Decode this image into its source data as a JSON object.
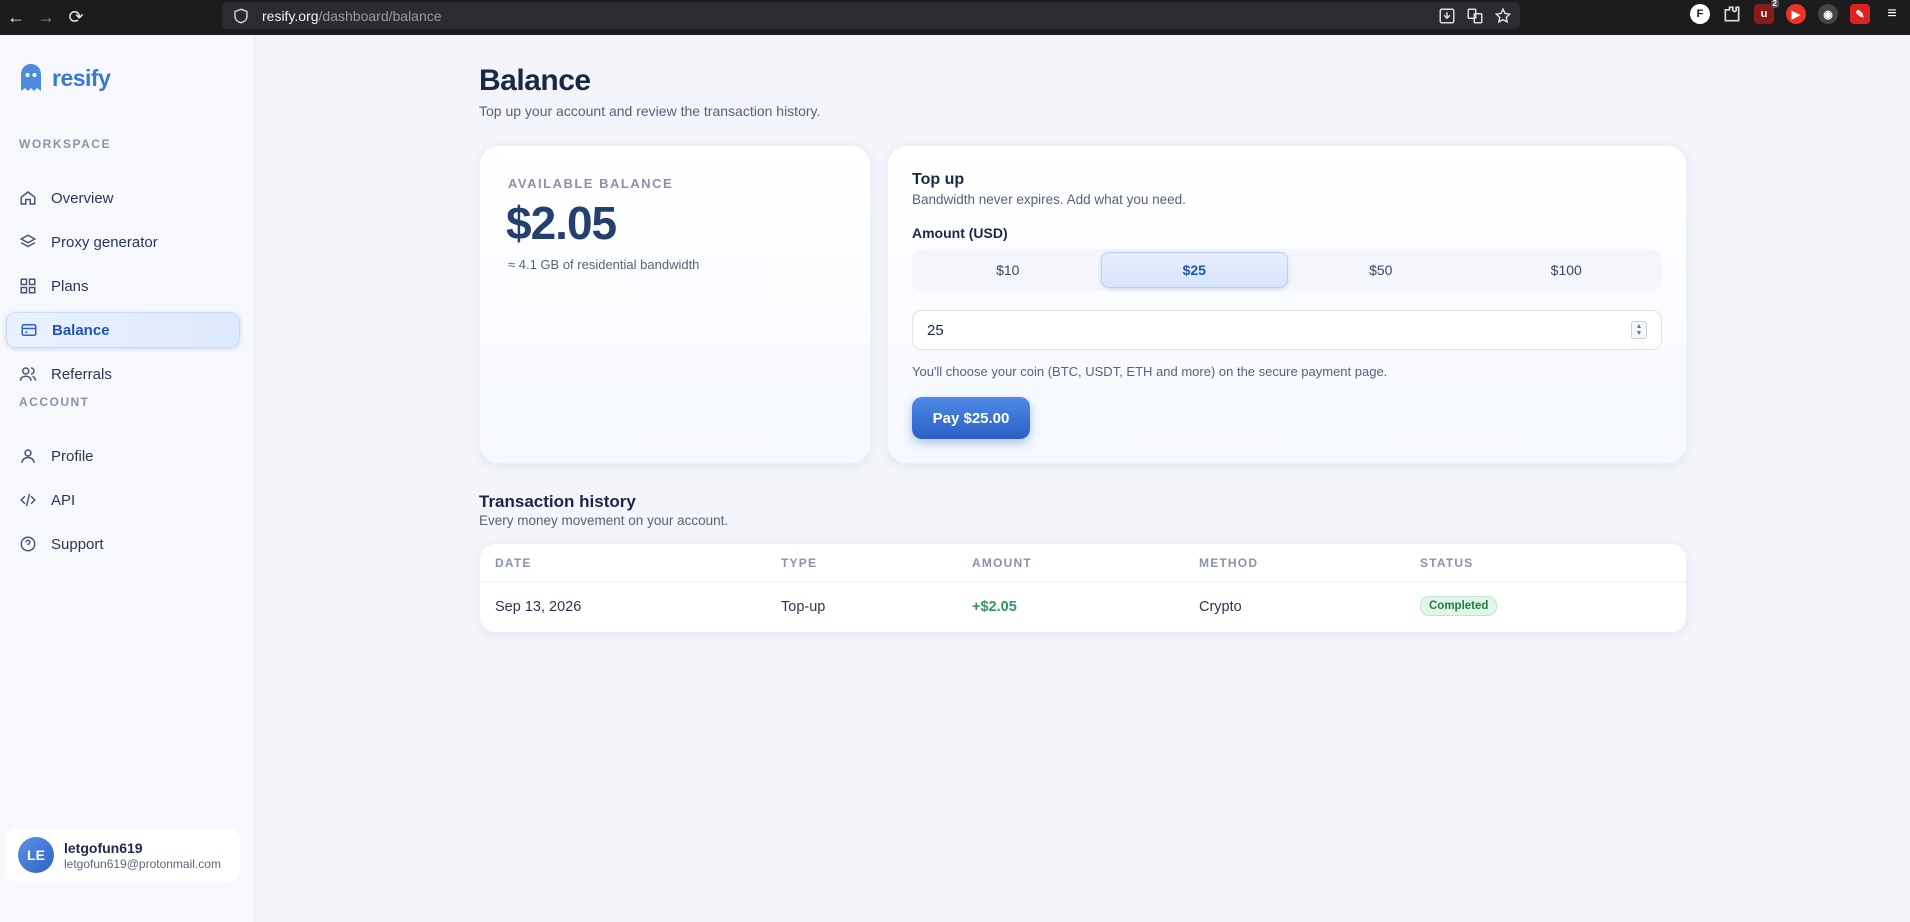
{
  "browser": {
    "url_host": "resify.org",
    "url_path": "/dashboard/balance",
    "extension_badge": "2"
  },
  "brand": {
    "name": "resify",
    "color": "#3b78d6"
  },
  "sidebar": {
    "workspace_label": "WORKSPACE",
    "account_label": "ACCOUNT",
    "workspace_items": [
      {
        "label": "Overview",
        "icon": "home-icon"
      },
      {
        "label": "Proxy generator",
        "icon": "layers-icon"
      },
      {
        "label": "Plans",
        "icon": "grid-icon"
      },
      {
        "label": "Balance",
        "icon": "card-icon",
        "active": true
      },
      {
        "label": "Referrals",
        "icon": "users-icon"
      }
    ],
    "account_items": [
      {
        "label": "Profile",
        "icon": "user-icon"
      },
      {
        "label": "API",
        "icon": "code-icon"
      },
      {
        "label": "Support",
        "icon": "help-icon"
      }
    ]
  },
  "user": {
    "initials": "LE",
    "name": "letgofun619",
    "email": "letgofun619@protonmail.com"
  },
  "page": {
    "title": "Balance",
    "subtitle": "Top up your account and review the transaction history."
  },
  "balance": {
    "label": "AVAILABLE BALANCE",
    "value": "$2.05",
    "note": "≈ 4.1 GB of residential bandwidth"
  },
  "topup": {
    "title": "Top up",
    "subtitle": "Bandwidth never expires. Add what you need.",
    "amount_label": "Amount (USD)",
    "presets": [
      "$10",
      "$25",
      "$50",
      "$100"
    ],
    "selected_preset": "$25",
    "amount_value": "25",
    "hint": "You'll choose your coin (BTC, USDT, ETH and more) on the secure payment page.",
    "pay_label": "Pay  $25.00"
  },
  "history": {
    "title": "Transaction history",
    "subtitle": "Every money movement on your account.",
    "columns": [
      "DATE",
      "TYPE",
      "AMOUNT",
      "METHOD",
      "STATUS"
    ],
    "rows": [
      {
        "date": "Sep 13, 2026",
        "type": "Top-up",
        "amount": "+$2.05",
        "method": "Crypto",
        "status": "Completed"
      }
    ]
  }
}
